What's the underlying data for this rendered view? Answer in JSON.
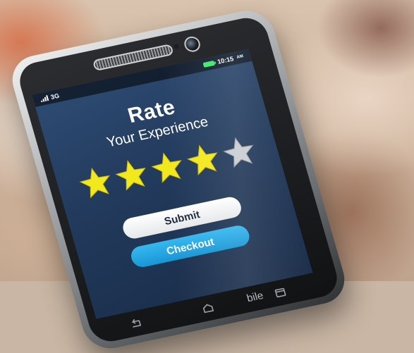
{
  "status_bar": {
    "network": "3G",
    "time": "10:15",
    "time_suffix": "AM"
  },
  "rating_screen": {
    "title": "Rate",
    "subtitle": "Your Experience",
    "rating": {
      "value": 4,
      "max": 5
    },
    "submit_label": "Submit",
    "checkout_label": "Checkout"
  },
  "device": {
    "brand_fragment": "bile"
  },
  "colors": {
    "star_filled": "#f2e81e",
    "star_empty": "#c9ccd0",
    "checkout_button": "#1ea6e4",
    "screen_background": "#223a5c"
  },
  "icons": {
    "nav_back": "back-icon",
    "nav_home": "home-icon",
    "nav_recent": "recent-apps-icon"
  }
}
